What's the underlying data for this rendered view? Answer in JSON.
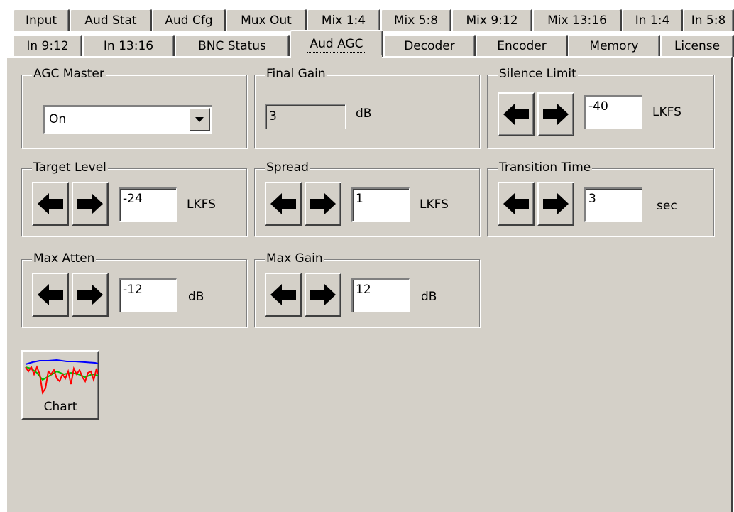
{
  "tabs_row1": [
    {
      "label": "Input"
    },
    {
      "label": "Aud Stat"
    },
    {
      "label": "Aud Cfg"
    },
    {
      "label": "Mux Out"
    },
    {
      "label": "Mix 1:4"
    },
    {
      "label": "Mix 5:8"
    },
    {
      "label": "Mix 9:12"
    },
    {
      "label": "Mix 13:16"
    },
    {
      "label": "In 1:4"
    },
    {
      "label": "In 5:8"
    }
  ],
  "tabs_row2": [
    {
      "label": "In 9:12"
    },
    {
      "label": "In 13:16"
    },
    {
      "label": "BNC Status"
    },
    {
      "label": "Aud AGC",
      "active": true
    },
    {
      "label": "Decoder"
    },
    {
      "label": "Encoder"
    },
    {
      "label": "Memory"
    },
    {
      "label": "License"
    }
  ],
  "agc_master": {
    "title": "AGC Master",
    "value": "On"
  },
  "final_gain": {
    "title": "Final Gain",
    "value": "3",
    "unit": "dB"
  },
  "silence_limit": {
    "title": "Silence Limit",
    "value": "-40",
    "unit": "LKFS"
  },
  "target_level": {
    "title": "Target Level",
    "value": "-24",
    "unit": "LKFS"
  },
  "spread": {
    "title": "Spread",
    "value": "1",
    "unit": "LKFS"
  },
  "transition_time": {
    "title": "Transition Time",
    "value": "3",
    "unit": "sec"
  },
  "max_atten": {
    "title": "Max Atten",
    "value": "-12",
    "unit": "dB"
  },
  "max_gain": {
    "title": "Max Gain",
    "value": "12",
    "unit": "dB"
  },
  "chart_button": {
    "label": "Chart"
  },
  "colors": {
    "face": "#d4d0c8",
    "shadow": "#808080",
    "dark": "#404040",
    "highlight": "#ffffff"
  },
  "icons": {
    "decrease": "left-arrow-icon",
    "increase": "right-arrow-icon",
    "dropdown": "chevron-down-icon",
    "chart": "chart-icon"
  }
}
